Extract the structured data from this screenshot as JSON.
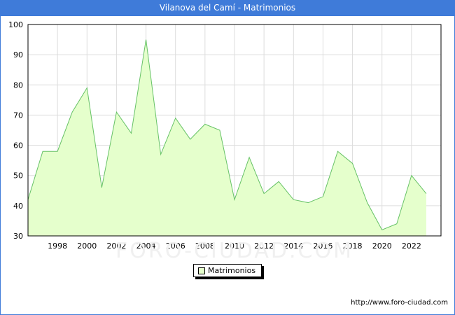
{
  "header": {
    "title": "Vilanova del Camí - Matrimonios"
  },
  "source": "http://www.foro-ciudad.com",
  "watermark": "FORO-CIUDAD.COM",
  "colors": {
    "title_bg": "#3f7bd9",
    "area_fill": "#e5ffcc",
    "area_line": "#66c266",
    "grid": "#dddddd"
  },
  "chart_data": {
    "type": "area",
    "title": "Vilanova del Camí - Matrimonios",
    "xlabel": "",
    "ylabel": "",
    "ylim": [
      30,
      100
    ],
    "y_ticks": [
      30,
      40,
      50,
      60,
      70,
      80,
      90,
      100
    ],
    "x_ticks": [
      1998,
      2000,
      2002,
      2004,
      2006,
      2008,
      2010,
      2012,
      2014,
      2016,
      2018,
      2020,
      2022
    ],
    "grid": true,
    "legend_position": "bottom-center",
    "series": [
      {
        "name": "Matrimonios",
        "x": [
          1996,
          1997,
          1998,
          1999,
          2000,
          2001,
          2002,
          2003,
          2004,
          2005,
          2006,
          2007,
          2008,
          2009,
          2010,
          2011,
          2012,
          2013,
          2014,
          2015,
          2016,
          2017,
          2018,
          2019,
          2020,
          2021,
          2022,
          2023
        ],
        "values": [
          42,
          58,
          58,
          71,
          79,
          46,
          71,
          64,
          95,
          57,
          69,
          62,
          67,
          65,
          42,
          56,
          44,
          48,
          42,
          41,
          43,
          58,
          54,
          41,
          32,
          34,
          50,
          44
        ]
      }
    ]
  }
}
